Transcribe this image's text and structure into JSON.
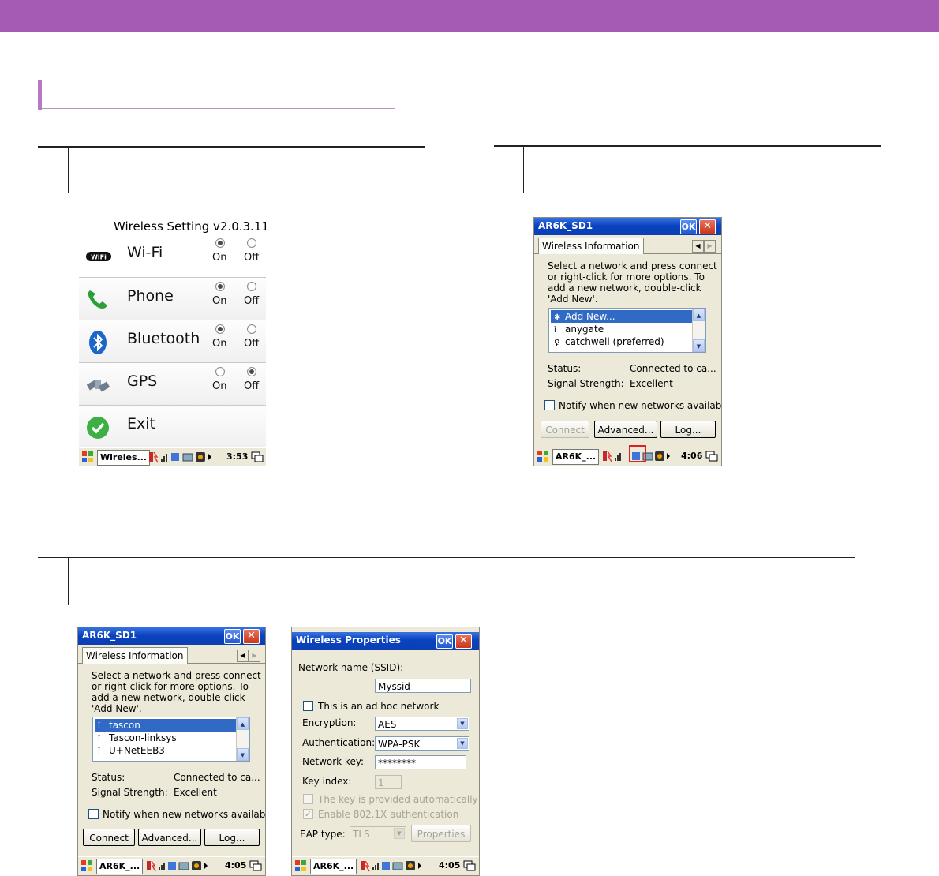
{
  "colors": {
    "header_bar": "#a55bb3",
    "section_accent": "#b878c6",
    "ce_title": "#0a43c0",
    "ce_face": "#ece9d8",
    "selection": "#316ac5",
    "highlight": "#e02020"
  },
  "wireless_setting": {
    "title": "Wireless Setting v2.0.3.11",
    "rows": [
      {
        "icon": "wifi-icon",
        "label": "Wi-Fi",
        "on": "On",
        "off": "Off",
        "selected": "on"
      },
      {
        "icon": "phone-icon",
        "label": "Phone",
        "on": "On",
        "off": "Off",
        "selected": "on"
      },
      {
        "icon": "bluetooth-icon",
        "label": "Bluetooth",
        "on": "On",
        "off": "Off",
        "selected": "on"
      },
      {
        "icon": "gps-icon",
        "label": "GPS",
        "on": "On",
        "off": "Off",
        "selected": "off"
      },
      {
        "icon": "exit-icon",
        "label": "Exit"
      }
    ],
    "taskbar": {
      "task": "Wireles...",
      "time": "3:53"
    }
  },
  "wireless_info_1": {
    "title": "AR6K_SD1",
    "ok": "OK",
    "tab": "Wireless Information",
    "instructions": [
      "Select a network and press connect",
      "or right-click for more options.  To",
      "add a new network, double-click",
      "'Add New'."
    ],
    "networks": [
      {
        "label": "Add New...",
        "icon": "new-network-icon"
      },
      {
        "label": "anygate",
        "icon": "network-icon"
      },
      {
        "label": "catchwell (preferred)",
        "icon": "preferred-network-icon"
      }
    ],
    "status_label": "Status:",
    "status_value": "Connected to ca...",
    "signal_label": "Signal Strength:",
    "signal_value": "Excellent",
    "notify": "Notify when new networks available",
    "connect": "Connect",
    "advanced": "Advanced...",
    "log": "Log...",
    "taskbar": {
      "task": "AR6K_...",
      "time": "4:06"
    }
  },
  "wireless_info_2": {
    "title": "AR6K_SD1",
    "ok": "OK",
    "tab": "Wireless Information",
    "instructions": [
      "Select a network and press connect",
      "or right-click for more options.  To",
      "add a new network, double-click",
      "'Add New'."
    ],
    "networks": [
      {
        "label": "tascon",
        "icon": "network-icon"
      },
      {
        "label": "Tascon-linksys",
        "icon": "network-icon"
      },
      {
        "label": "U+NetEEB3",
        "icon": "network-icon"
      }
    ],
    "status_label": "Status:",
    "status_value": "Connected to ca...",
    "signal_label": "Signal Strength:",
    "signal_value": "Excellent",
    "notify": "Notify when new networks available",
    "connect": "Connect",
    "advanced": "Advanced...",
    "log": "Log...",
    "taskbar": {
      "task": "AR6K_...",
      "time": "4:05"
    }
  },
  "wireless_props": {
    "title": "Wireless Properties",
    "ok": "OK",
    "ssid_label": "Network name (SSID):",
    "ssid_value": "Myssid",
    "adhoc": "This is an ad hoc network",
    "encryption_label": "Encryption:",
    "encryption_value": "AES",
    "auth_label": "Authentication:",
    "auth_value": "WPA-PSK",
    "key_label": "Network key:",
    "key_value": "********",
    "index_label": "Key index:",
    "index_value": "1",
    "auto_key": "The key is provided automatically",
    "enable_8021x": "Enable 802.1X authentication",
    "eap_label": "EAP type:",
    "eap_value": "TLS",
    "properties": "Properties",
    "taskbar": {
      "task": "AR6K_...",
      "time": "4:05"
    }
  }
}
